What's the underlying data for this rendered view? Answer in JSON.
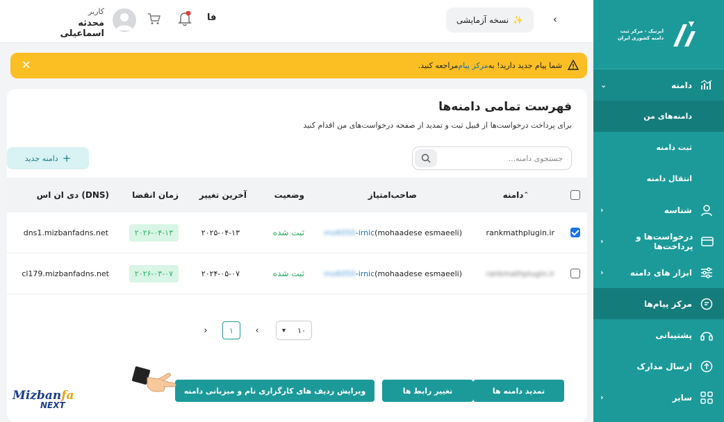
{
  "sidebar": {
    "logo_text_1": "ایرنیک - مرکز ثبت",
    "logo_text_2": "دامنه کشوری ایران",
    "domain_section": "دامنه",
    "sub_items": [
      "دامنه‌های من",
      "ثبت دامنه",
      "انتقال دامنه"
    ],
    "items": [
      "شناسه",
      "درخواست‌ها و پرداخت‌ها",
      "ابزار های دامنه",
      "مرکز پیام‌ها",
      "پشتیبانی",
      "ارسال مدارک",
      "سایر"
    ]
  },
  "topbar": {
    "trial_label": "نسخه آزمایشی",
    "lang": "فا",
    "user_role": "کاربر",
    "user_name": "محدثه اسماعیلی"
  },
  "alert": {
    "text_before": "شما پیام جدید دارید! به ",
    "link": "مرکز پیام",
    "text_after": " مراجعه کنید."
  },
  "page": {
    "title": "فهرست تمامی دامنه‌ها",
    "subtitle": "برای پرداخت درخواست‌ها از قبیل ثبت و تمدید از صفحه درخواست‌های من اقدام کنید",
    "search_placeholder": "جستجوی دامنه...",
    "new_domain": "دامنه جدید"
  },
  "table": {
    "headers": {
      "domain": "دامنه",
      "holder": "صاحب‌امتیاز",
      "status": "وضعیت",
      "last_change": "آخرین تغییر",
      "expiry": "زمان انقضا",
      "dns": "دی ان اس (DNS)"
    },
    "rows": [
      {
        "checked": true,
        "domain": "rankmathplugin.ir",
        "holder_id": "mo6050",
        "holder_suffix": "-irnic",
        "holder_name": " (mohaadese esmaeeli)",
        "status": "ثبت شده",
        "last_change": "۲۰۲۵-۰۴-۱۳",
        "expiry": "۲۰۲۶-۰۴-۱۳",
        "dns": "dns1.mizbanfadns.net"
      },
      {
        "checked": false,
        "domain": "rankmathplugin.ir",
        "holder_id": "mo6050",
        "holder_suffix": "-irnic",
        "holder_name": " (mohaadese esmaeeli)",
        "status": "ثبت شده",
        "last_change": "۲۰۲۴-۰۵-۰۷",
        "expiry": "۲۰۲۶-۰۳-۰۷",
        "dns": "cl179.mizbanfadns.net"
      }
    ]
  },
  "pagination": {
    "current_page": "۱",
    "per_page": "۱۰"
  },
  "actions": {
    "renew": "تمدید دامنه ها",
    "change_link": "تغییر رابط ها",
    "edit_records": "ویرایش ردیف های کارگزاری نام و میزبانی دامنه"
  },
  "brand": {
    "line1_a": "Mizban",
    "line1_b": "fa",
    "line2": "NEXT"
  },
  "colors": {
    "primary": "#1c9a9a",
    "alert": "#fbbf24",
    "success": "#22a95a"
  }
}
